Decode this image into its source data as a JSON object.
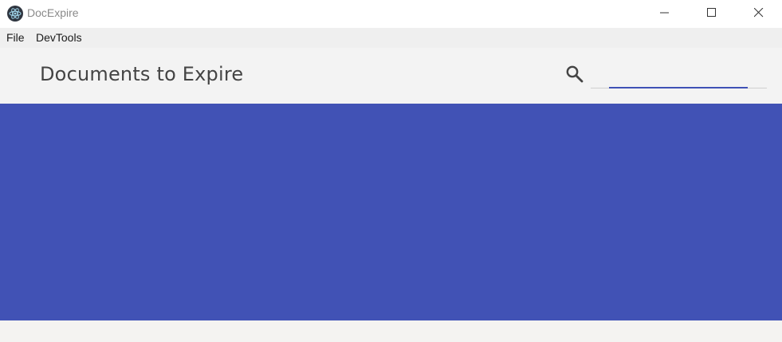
{
  "window": {
    "title": "DocExpire",
    "icon": "electron-atom-icon"
  },
  "window_controls": {
    "minimize_icon": "minimize-icon",
    "maximize_icon": "maximize-icon",
    "close_icon": "close-icon"
  },
  "menubar": {
    "items": [
      {
        "label": "File"
      },
      {
        "label": "DevTools"
      }
    ]
  },
  "appbar": {
    "title": "Documents to Expire",
    "search": {
      "icon": "search-icon",
      "value": "",
      "placeholder": ""
    }
  },
  "colors": {
    "primary": "#3f51b5",
    "banner": "#4152b5",
    "appbar_bg": "#f3f3f3",
    "menubar_bg": "#efefef",
    "page_bg": "#f4f3f1"
  }
}
